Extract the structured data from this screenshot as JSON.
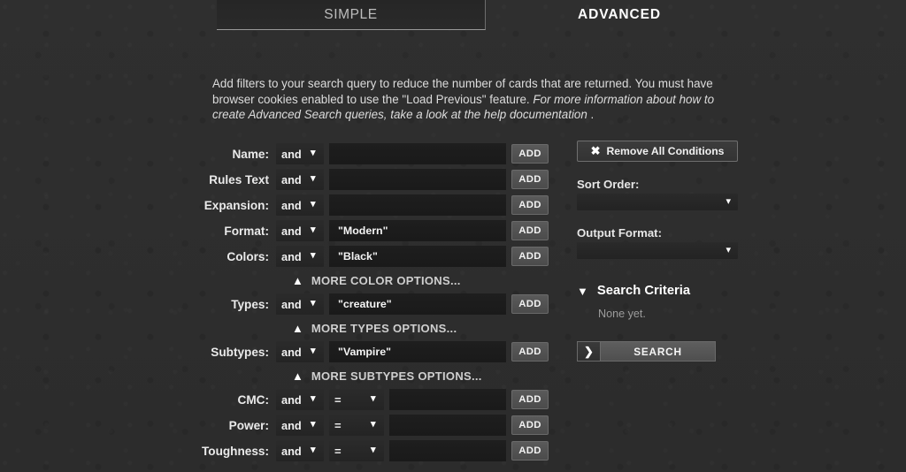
{
  "tabs": [
    {
      "id": "simple",
      "label": "SIMPLE",
      "active": false
    },
    {
      "id": "advanced",
      "label": "ADVANCED",
      "active": true
    }
  ],
  "intro": {
    "part1": "Add filters to your search query to reduce the number of cards that are returned. You must have browser cookies enabled to use the \"Load Previous\" feature. ",
    "part2": "For more information about how to create Advanced Search queries, take a look at the help documentation",
    "part3": " ."
  },
  "form": {
    "conjunction_value": "and",
    "operator_value": "=",
    "add_label": "ADD",
    "rows": [
      {
        "label": "Name:",
        "conj": "and",
        "op": null,
        "value": "",
        "add": "ADD"
      },
      {
        "label": "Rules Text",
        "conj": "and",
        "op": null,
        "value": "",
        "add": "ADD"
      },
      {
        "label": "Expansion:",
        "conj": "and",
        "op": null,
        "value": "",
        "add": "ADD"
      },
      {
        "label": "Format:",
        "conj": "and",
        "op": null,
        "value": "\"Modern\"",
        "add": "ADD"
      },
      {
        "label": "Colors:",
        "conj": "and",
        "op": null,
        "value": "\"Black\"",
        "add": "ADD"
      },
      {
        "label": "Types:",
        "conj": "and",
        "op": null,
        "value": "\"creature\"",
        "add": "ADD"
      },
      {
        "label": "Subtypes:",
        "conj": "and",
        "op": null,
        "value": "\"Vampire\"",
        "add": "ADD"
      },
      {
        "label": "CMC:",
        "conj": "and",
        "op": "=",
        "value": "",
        "add": "ADD"
      },
      {
        "label": "Power:",
        "conj": "and",
        "op": "=",
        "value": "",
        "add": "ADD"
      },
      {
        "label": "Toughness:",
        "conj": "and",
        "op": "=",
        "value": "",
        "add": "ADD"
      }
    ],
    "more_links": [
      {
        "label": "MORE COLOR OPTIONS...",
        "icon": "chevron-up-icon"
      },
      {
        "label": "MORE TYPES OPTIONS...",
        "icon": "chevron-up-icon"
      },
      {
        "label": "MORE SUBTYPES OPTIONS...",
        "icon": "chevron-up-icon"
      }
    ]
  },
  "panel": {
    "remove_all_label": "Remove All Conditions",
    "remove_all_icon": "x-close-icon",
    "sort_order_label": "Sort Order:",
    "sort_order_value": "",
    "output_format_label": "Output Format:",
    "output_format_value": "",
    "criteria_title": "Search Criteria",
    "criteria_icon": "chevron-down-icon",
    "criteria_empty": "None yet.",
    "search_label": "SEARCH",
    "search_icon": "chevron-right-icon"
  },
  "colors": {
    "background": "#2e2e2e",
    "text": "#d8d8d8",
    "accent_button": "#5a5a5a",
    "input_bg": "#1c1c1c",
    "muted_text": "#9c9c9c"
  }
}
